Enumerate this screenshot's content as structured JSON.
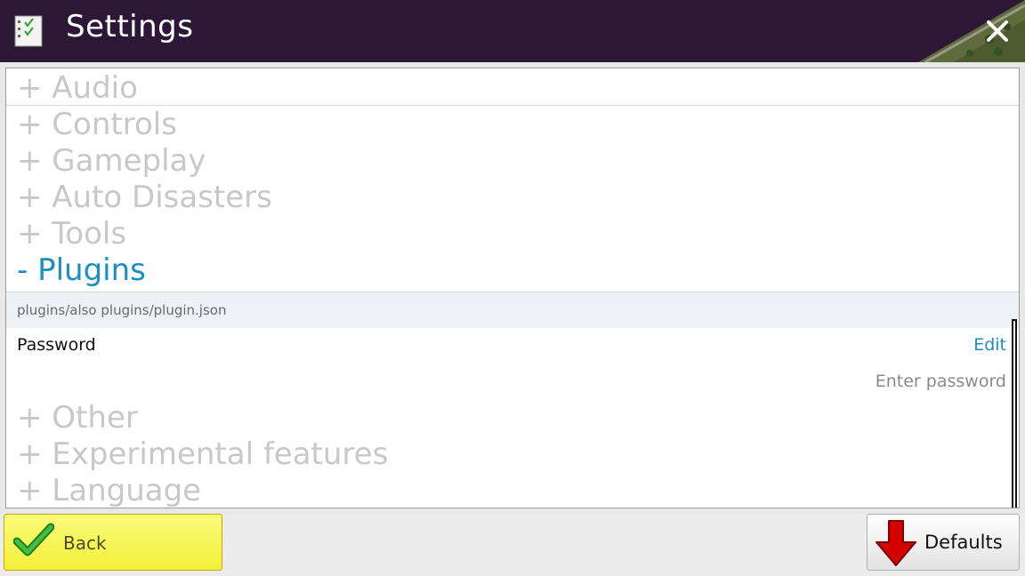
{
  "window": {
    "title": "Settings",
    "close_icon": "close-icon",
    "settings_icon": "checklist-icon"
  },
  "sections": {
    "audio": "+ Audio",
    "controls": "+ Controls",
    "gameplay": "+ Gameplay",
    "auto_disasters": "+ Auto Disasters",
    "tools": "+ Tools",
    "plugins": "- Plugins",
    "other": "+ Other",
    "experimental": "+ Experimental features",
    "language": "+ Language"
  },
  "plugins": {
    "path": "plugins/also plugins/plugin.json",
    "password_label": "Password",
    "edit_label": "Edit",
    "password_placeholder": "Enter password"
  },
  "footer": {
    "back_label": "Back",
    "defaults_label": "Defaults"
  },
  "colors": {
    "titlebar": "#2c1836",
    "accent": "#1a8fc0",
    "collapsed_section": "#c8c8c8",
    "back_button": "#f2f03a"
  }
}
